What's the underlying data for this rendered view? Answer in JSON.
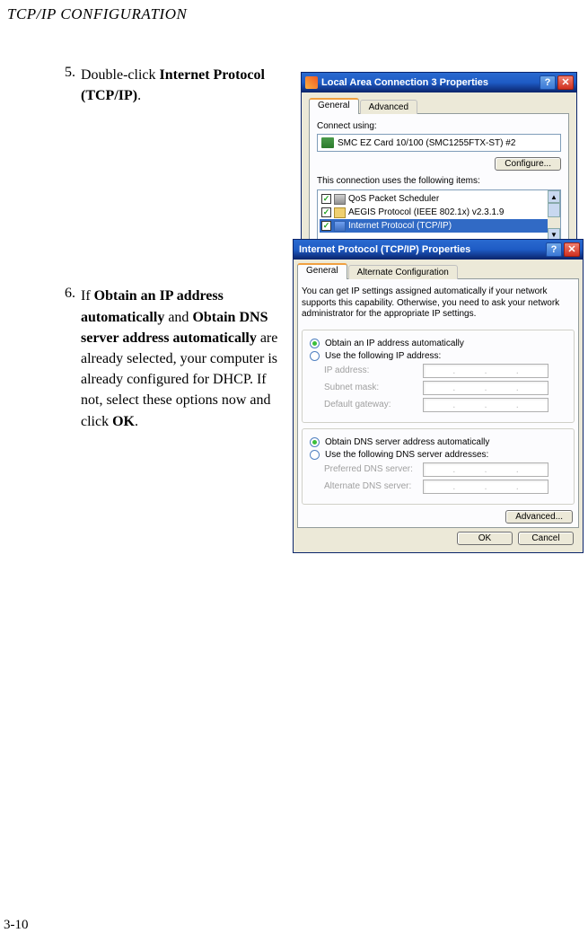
{
  "header": "TCP/IP CONFIGURATION",
  "page_number": "3-10",
  "steps": {
    "s5": {
      "num": "5.",
      "pre": "Double-click ",
      "b1": "Internet Protocol (TCP/IP)",
      "post": "."
    },
    "s6": {
      "num": "6.",
      "t0": "If ",
      "b1": "Obtain an IP address automatically",
      "t1": " and ",
      "b2": "Obtain DNS server address automatically",
      "t2": " are already selected, your computer is already configured for DHCP. If not, select these options now and click ",
      "b3": "OK",
      "t3": "."
    }
  },
  "dlg1": {
    "title": "Local Area Connection 3 Properties",
    "help": "?",
    "close": "✕",
    "tab_general": "General",
    "tab_advanced": "Advanced",
    "connect_using": "Connect using:",
    "nic": "SMC EZ Card 10/100 (SMC1255FTX-ST) #2",
    "configure": "Configure...",
    "items_label": "This connection uses the following items:",
    "items": [
      {
        "label": "QoS Packet Scheduler",
        "kind": "net",
        "checked": true,
        "sel": false
      },
      {
        "label": "AEGIS Protocol (IEEE 802.1x) v2.3.1.9",
        "kind": "proto",
        "checked": true,
        "sel": false
      },
      {
        "label": "Internet Protocol (TCP/IP)",
        "kind": "proto-blue",
        "checked": true,
        "sel": true
      }
    ]
  },
  "dlg2": {
    "title": "Internet Protocol (TCP/IP) Properties",
    "help": "?",
    "close": "✕",
    "tab_general": "General",
    "tab_alt": "Alternate Configuration",
    "desc": "You can get IP settings assigned automatically if your network supports this capability. Otherwise, you need to ask your network administrator for the appropriate IP settings.",
    "r_ip_auto": "Obtain an IP address automatically",
    "r_ip_manual": "Use the following IP address:",
    "f_ip": "IP address:",
    "f_mask": "Subnet mask:",
    "f_gw": "Default gateway:",
    "r_dns_auto": "Obtain DNS server address automatically",
    "r_dns_manual": "Use the following DNS server addresses:",
    "f_dns1": "Preferred DNS server:",
    "f_dns2": "Alternate DNS server:",
    "advanced": "Advanced...",
    "ok": "OK",
    "cancel": "Cancel"
  }
}
